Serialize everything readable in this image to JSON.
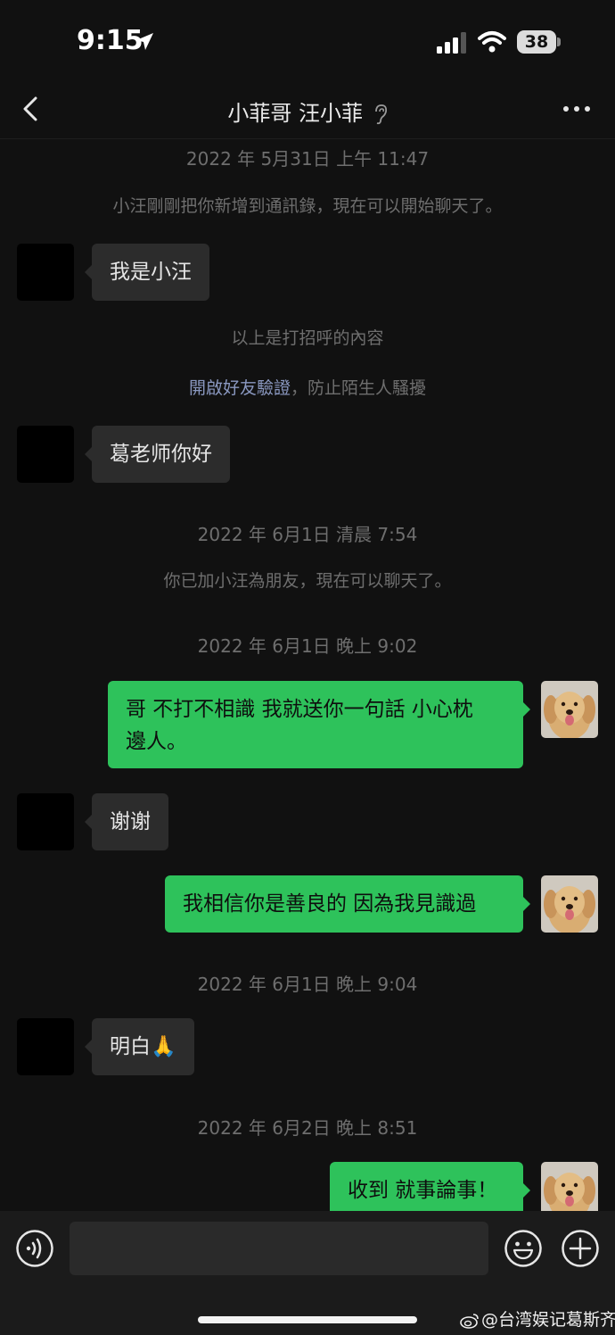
{
  "status_bar": {
    "time": "9:15",
    "battery": "38"
  },
  "nav": {
    "title": "小菲哥 汪小菲"
  },
  "messages": {
    "ts1": "2022 年 5月31日 上午 11:47",
    "sys1": "小汪剛剛把你新增到通訊錄，現在可以開始聊天了。",
    "m1": "我是小汪",
    "sys2": "以上是打招呼的內容",
    "sys3_link": "開啟好友驗證",
    "sys3_rest": "，防止陌生人騷擾",
    "m2": "葛老师你好",
    "ts2": "2022 年 6月1日 清晨 7:54",
    "sys4": "你已加小汪為朋友，現在可以聊天了。",
    "ts3": "2022 年 6月1日 晚上 9:02",
    "m3_line1": "哥 不打不相識 我就送你一句話 小心枕",
    "m3_line2": "邊人。",
    "m4": "谢谢",
    "m5": "我相信你是善良的 因為我見識過",
    "ts4": "2022 年 6月1日 晚上 9:04",
    "m6": "明白🙏",
    "ts5": "2022 年 6月2日 晚上 8:51",
    "m7": "收到 就事論事！"
  },
  "input": {
    "placeholder": ""
  },
  "watermark": "@台湾娱记葛斯齐",
  "colors": {
    "background": "#111111",
    "bubble_self": "#2ec25b",
    "bubble_other": "#2c2c2c",
    "link": "#8a98c0"
  }
}
